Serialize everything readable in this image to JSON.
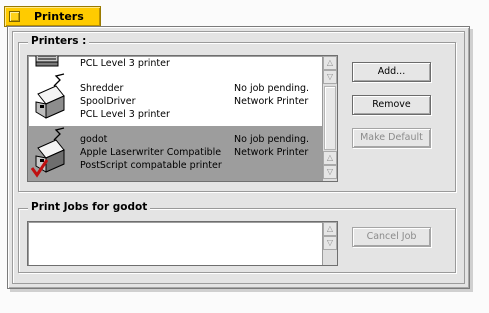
{
  "window": {
    "title": "Printers"
  },
  "printers_group": {
    "label": "Printers :",
    "items": [
      {
        "name": "",
        "driver": "",
        "description": "PCL Level 3 printer",
        "status": "",
        "type": "",
        "selected": false,
        "default": false
      },
      {
        "name": "Shredder",
        "driver": "SpoolDriver",
        "description": "PCL Level 3 printer",
        "status": "No job pending.",
        "type": "Network Printer",
        "selected": false,
        "default": false
      },
      {
        "name": "godot",
        "driver": "Apple Laserwriter Compatible",
        "description": "PostScript compatable printer",
        "status": "No job pending.",
        "type": "Network Printer",
        "selected": true,
        "default": true
      }
    ]
  },
  "buttons": {
    "add": "Add...",
    "remove": "Remove",
    "make_default": "Make Default",
    "cancel_job": "Cancel Job"
  },
  "jobs_group": {
    "label": "Print Jobs for godot"
  },
  "colors": {
    "tab": "#ffcb00",
    "selection": "#9d9d9d",
    "panel": "#e4e4e4"
  },
  "icons": {
    "printer": "printer-icon",
    "default_check": "checkmark-icon",
    "scroll_up": "arrow-up-icon",
    "scroll_down": "arrow-down-icon"
  }
}
